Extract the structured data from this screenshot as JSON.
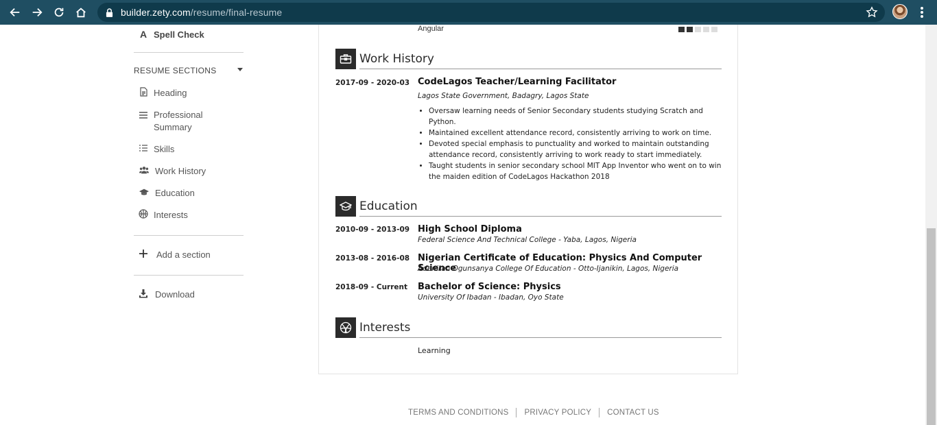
{
  "browser": {
    "url_host": "builder.zety.com",
    "url_path": "/resume/final-resume"
  },
  "sidebar": {
    "spell_check": "Spell Check",
    "sections_title": "RESUME SECTIONS",
    "items": [
      {
        "label": "Heading",
        "icon": "document-icon"
      },
      {
        "label": "Professional Summary",
        "icon": "list-lines-icon"
      },
      {
        "label": "Skills",
        "icon": "checklist-icon"
      },
      {
        "label": "Work History",
        "icon": "users-icon"
      },
      {
        "label": "Education",
        "icon": "graduation-cap-icon"
      },
      {
        "label": "Interests",
        "icon": "basketball-icon"
      }
    ],
    "add_section": "Add a section",
    "download": "Download"
  },
  "resume": {
    "skill_partial": {
      "name": "Angular",
      "rating": 2,
      "rating_max": 5
    },
    "work_history": {
      "title": "Work History",
      "jobs": [
        {
          "dates": "2017-09 - 2020-03",
          "title": "CodeLagos Teacher/Learning Facilitator",
          "employer": "Lagos State Government, Badagry, Lagos State",
          "bullets": [
            "Oversaw learning needs of Senior Secondary students studying Scratch and Python.",
            "Maintained excellent attendance record, consistently arriving to work on time.",
            "Devoted special emphasis to punctuality and worked to maintain outstanding attendance record, consistently arriving to work ready to start immediately.",
            "Taught students in senior secondary school MIT App Inventor who went on to win the maiden edition of CodeLagos Hackathon 2018"
          ]
        }
      ]
    },
    "education": {
      "title": "Education",
      "entries": [
        {
          "dates": "2010-09 - 2013-09",
          "degree": "High School Diploma",
          "school": "Federal Science And Technical College - Yaba, Lagos, Nigeria"
        },
        {
          "dates": "2013-08 - 2016-08",
          "degree": "Nigerian Certificate of Education: Physics And Computer Science",
          "school": "Adeniran Ogunsanya College Of Education - Otto-Ijanikin, Lagos, Nigeria"
        },
        {
          "dates": "2018-09 - Current",
          "degree": "Bachelor of Science: Physics",
          "school": "University Of Ibadan - Ibadan, Oyo State"
        }
      ]
    },
    "interests": {
      "title": "Interests",
      "items": [
        "Learning"
      ]
    }
  },
  "footer": {
    "terms": "TERMS AND CONDITIONS",
    "privacy": "PRIVACY POLICY",
    "contact": "CONTACT US"
  }
}
